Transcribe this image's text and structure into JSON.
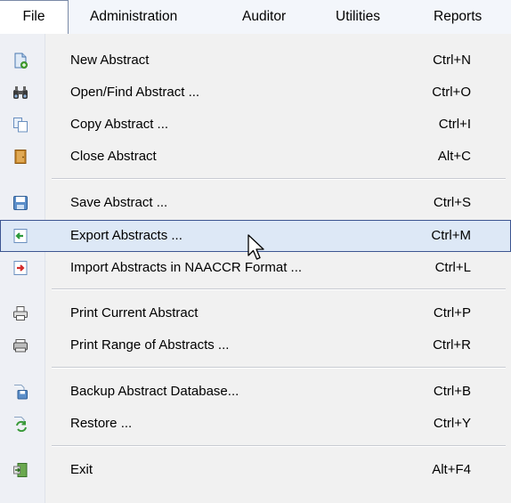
{
  "menubar": {
    "items": [
      {
        "label": "File",
        "open": true
      },
      {
        "label": "Administration"
      },
      {
        "label": "Auditor"
      },
      {
        "label": "Utilities"
      },
      {
        "label": "Reports"
      }
    ]
  },
  "file_menu": {
    "items": [
      {
        "label": "New Abstract",
        "shortcut": "Ctrl+N",
        "icon": "new-document-icon"
      },
      {
        "label": "Open/Find Abstract ...",
        "shortcut": "Ctrl+O",
        "icon": "binoculars-icon"
      },
      {
        "label": "Copy Abstract ...",
        "shortcut": "Ctrl+I",
        "icon": "copy-icon"
      },
      {
        "label": "Close Abstract",
        "shortcut": "Alt+C",
        "icon": "close-book-icon"
      },
      {
        "label": "Save Abstract ...",
        "shortcut": "Ctrl+S",
        "icon": "floppy-disk-icon"
      },
      {
        "label": "Export Abstracts ...",
        "shortcut": "Ctrl+M",
        "icon": "export-icon",
        "highlighted": true
      },
      {
        "label": "Import Abstracts in NAACCR Format ...",
        "shortcut": "Ctrl+L",
        "icon": "import-icon"
      },
      {
        "label": "Print Current Abstract",
        "shortcut": "Ctrl+P",
        "icon": "printer-icon"
      },
      {
        "label": "Print Range of Abstracts ...",
        "shortcut": "Ctrl+R",
        "icon": "printer-range-icon"
      },
      {
        "label": "Backup Abstract Database...",
        "shortcut": "Ctrl+B",
        "icon": "backup-database-icon"
      },
      {
        "label": "Restore ...",
        "shortcut": "Ctrl+Y",
        "icon": "restore-icon"
      },
      {
        "label": "Exit",
        "shortcut": "Alt+F4",
        "icon": "exit-door-icon"
      }
    ]
  },
  "colors": {
    "highlight_bg": "#dde8f6",
    "highlight_border": "#3c5591",
    "menu_bg": "#f1f1f1"
  }
}
